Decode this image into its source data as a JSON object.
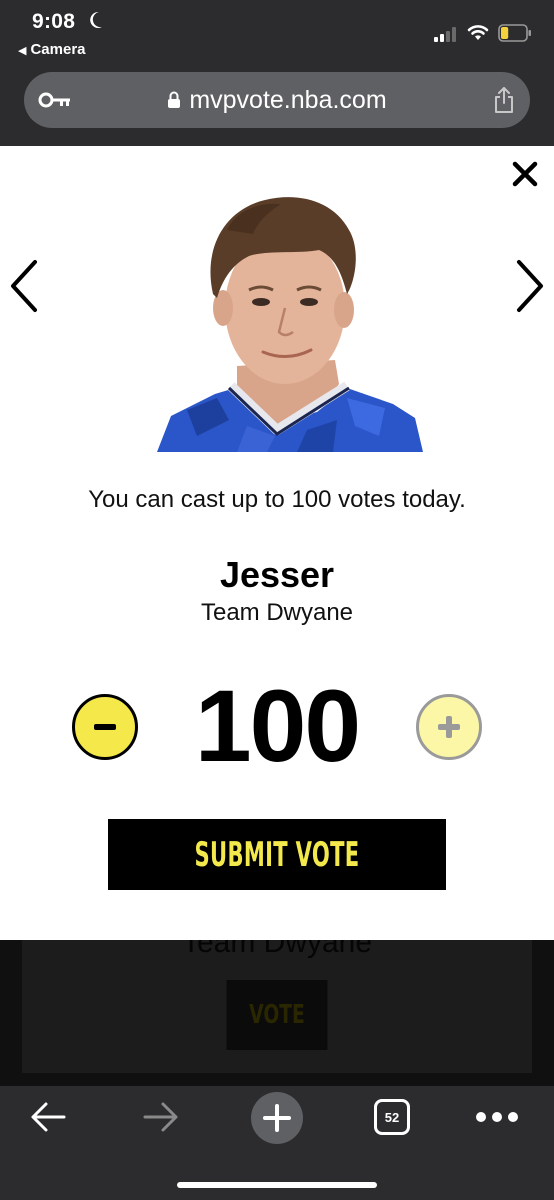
{
  "status_bar": {
    "time": "9:08",
    "back_app": "Camera",
    "signal_bars": 2,
    "battery_level": 0.3,
    "battery_color": "#f4d23c"
  },
  "browser": {
    "url": "mvpvote.nba.com",
    "key_icon": "key-icon",
    "lock_icon": "lock-icon",
    "share_icon": "share-icon"
  },
  "modal": {
    "vote_limit_text": "You can cast up to 100 votes today.",
    "player_name": "Jesser",
    "player_team": "Team Dwyane",
    "vote_count": "100",
    "submit_label": "SUBMIT VOTE",
    "accent_color": "#f4e84a",
    "icons": {
      "close": "close-icon",
      "previous": "chevron-left-icon",
      "next": "chevron-right-icon",
      "decrement": "minus-icon",
      "increment": "plus-icon"
    }
  },
  "background_page": {
    "team_text": "Team Dwyane",
    "vote_label": "VOTE"
  },
  "toolbar": {
    "tab_count": "52",
    "icons": [
      "back-arrow-icon",
      "forward-arrow-icon",
      "new-tab-icon",
      "tabs-icon",
      "more-icon"
    ]
  }
}
